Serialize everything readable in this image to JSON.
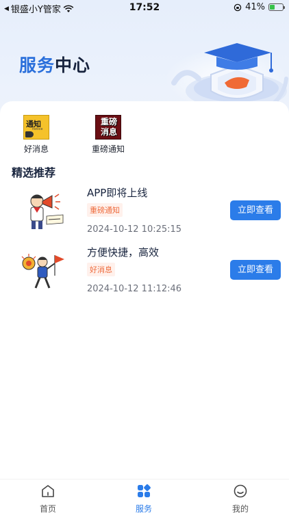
{
  "status_bar": {
    "carrier": "银盛小Y管家",
    "time": "17:52",
    "battery_text": "41%",
    "battery_level": 0.41
  },
  "header": {
    "title_part1": "服务",
    "title_part2": "中心"
  },
  "categories": [
    {
      "label": "好消息",
      "icon": "notice-megaphone-icon",
      "icon_text": "通知",
      "icon_subtext": "notice"
    },
    {
      "label": "重磅通知",
      "icon": "important-news-icon",
      "icon_text": "重磅消息"
    }
  ],
  "section_title": "精选推荐",
  "news": [
    {
      "title": "APP即将上线",
      "tag": "重磅通知",
      "time": "2024-10-12 10:25:15",
      "button": "立即查看"
    },
    {
      "title": "方便快捷，高效",
      "tag": "好消息",
      "time": "2024-10-12 11:12:46",
      "button": "立即查看"
    }
  ],
  "bottom_nav": [
    {
      "label": "首页",
      "icon": "home-icon",
      "active": false
    },
    {
      "label": "服务",
      "icon": "service-grid-icon",
      "active": true
    },
    {
      "label": "我的",
      "icon": "profile-smile-icon",
      "active": false
    }
  ],
  "colors": {
    "accent": "#2b7ce9",
    "title_blue": "#2a6fdb",
    "tag_text": "#ee6b3d",
    "tag_bg": "#fff1ec"
  }
}
